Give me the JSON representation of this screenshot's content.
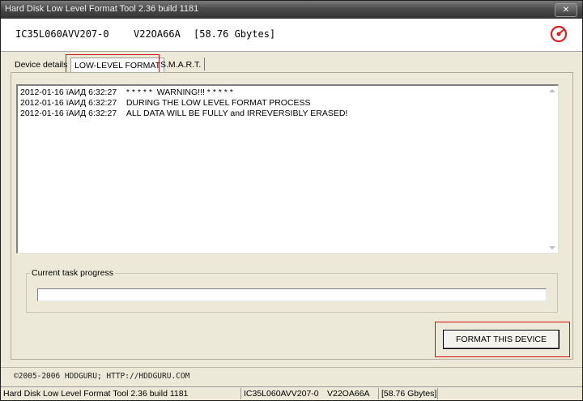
{
  "window": {
    "title": "Hard Disk Low Level Format Tool 2.36 build 1181",
    "close_label": "✕"
  },
  "device": {
    "model": "IC35L060AVV207-0",
    "firmware": "V22OA66A",
    "size": "[58.76 Gbytes]"
  },
  "tabs": [
    {
      "label": "Device details",
      "active": false
    },
    {
      "label": "LOW-LEVEL FORMAT",
      "active": true
    },
    {
      "label": "S.M.A.R.T.",
      "active": false
    }
  ],
  "log": {
    "lines": [
      {
        "time": "2012-01-16 ïАИД 6:32:27",
        "message": "  * * * * *  WARNING!!! * * * * *"
      },
      {
        "time": "2012-01-16 ïАИД 6:32:27",
        "message": "DURING THE LOW LEVEL FORMAT PROCESS"
      },
      {
        "time": "2012-01-16 ïАИД 6:32:27",
        "message": "ALL DATA WILL BE FULLY and IRREVERSIBLY ERASED!"
      }
    ]
  },
  "progress": {
    "label": "Current task progress",
    "value_percent": 0
  },
  "format_button": {
    "label": "FORMAT THIS DEVICE"
  },
  "footer": {
    "copyright": "©2005-2006 HDDGURU;  HTTP://HDDGURU.COM"
  },
  "statusbar": {
    "app": "Hard Disk Low Level Format Tool 2.36 build 1181",
    "model": "IC35L060AVV207-0",
    "firmware": "V22OA66A",
    "size": "[58.76 Gbytes]"
  },
  "icons": {
    "logo": "hddguru-logo-icon",
    "scroll_up": "scroll-up-arrow-icon",
    "scroll_down": "scroll-down-arrow-icon"
  },
  "colors": {
    "highlight": "#d01010",
    "logo_red": "#e02020"
  }
}
